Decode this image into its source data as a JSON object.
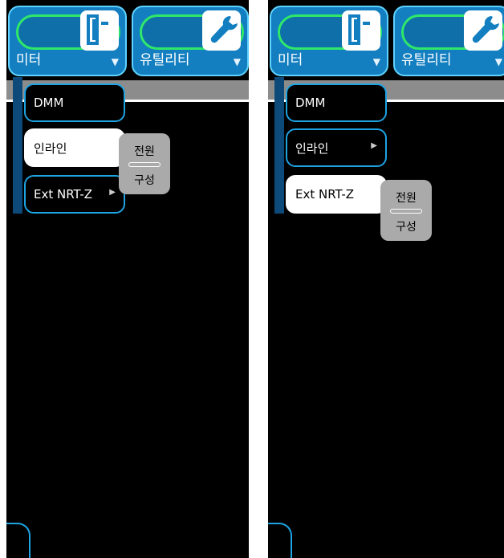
{
  "panels": [
    {
      "top_buttons": [
        {
          "label": "미터",
          "icon": "meter-icon"
        },
        {
          "label": "유틸리티",
          "icon": "wrench-icon"
        }
      ],
      "menu": [
        {
          "label": "DMM"
        },
        {
          "label": "인라인"
        },
        {
          "label": "Ext NRT-Z"
        }
      ],
      "selected_index": 1,
      "submenu": {
        "item1": "전원",
        "item2": "구성"
      }
    },
    {
      "top_buttons": [
        {
          "label": "미터",
          "icon": "meter-icon"
        },
        {
          "label": "유틸리티",
          "icon": "wrench-icon"
        }
      ],
      "menu": [
        {
          "label": "DMM"
        },
        {
          "label": "인라인"
        },
        {
          "label": "Ext NRT-Z"
        }
      ],
      "selected_index": 2,
      "submenu": {
        "item1": "전원",
        "item2": "구성"
      }
    }
  ],
  "colors": {
    "button_blue": "#137fc0",
    "accent_green": "#2fe86a",
    "menu_border": "#1ea3e3",
    "submenu_gray": "#aaaaaa"
  }
}
